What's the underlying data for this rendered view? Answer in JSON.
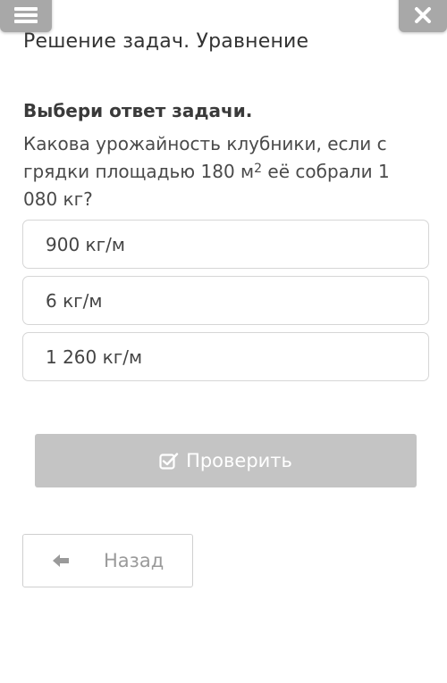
{
  "header": {
    "menu_icon": "hamburger-icon",
    "close_icon": "close-icon",
    "title": "Решение задач. Уравнение"
  },
  "task": {
    "instruction": "Выбери ответ задачи.",
    "question_part1": "Какова урожайность клубники, если с грядки площадью 180 м",
    "question_sup": "2",
    "question_part2": " её собрали 1 080 кг?"
  },
  "answers": [
    {
      "label": "900 кг/м"
    },
    {
      "label": "6 кг/м"
    },
    {
      "label": "1 260 кг/м"
    }
  ],
  "actions": {
    "check_label": "Проверить",
    "check_icon": "checkbox-check-icon",
    "back_label": "Назад",
    "back_icon": "arrow-left-icon"
  },
  "colors": {
    "header_button": "#a8a8a8",
    "check_button_disabled": "#c4c4c4"
  }
}
